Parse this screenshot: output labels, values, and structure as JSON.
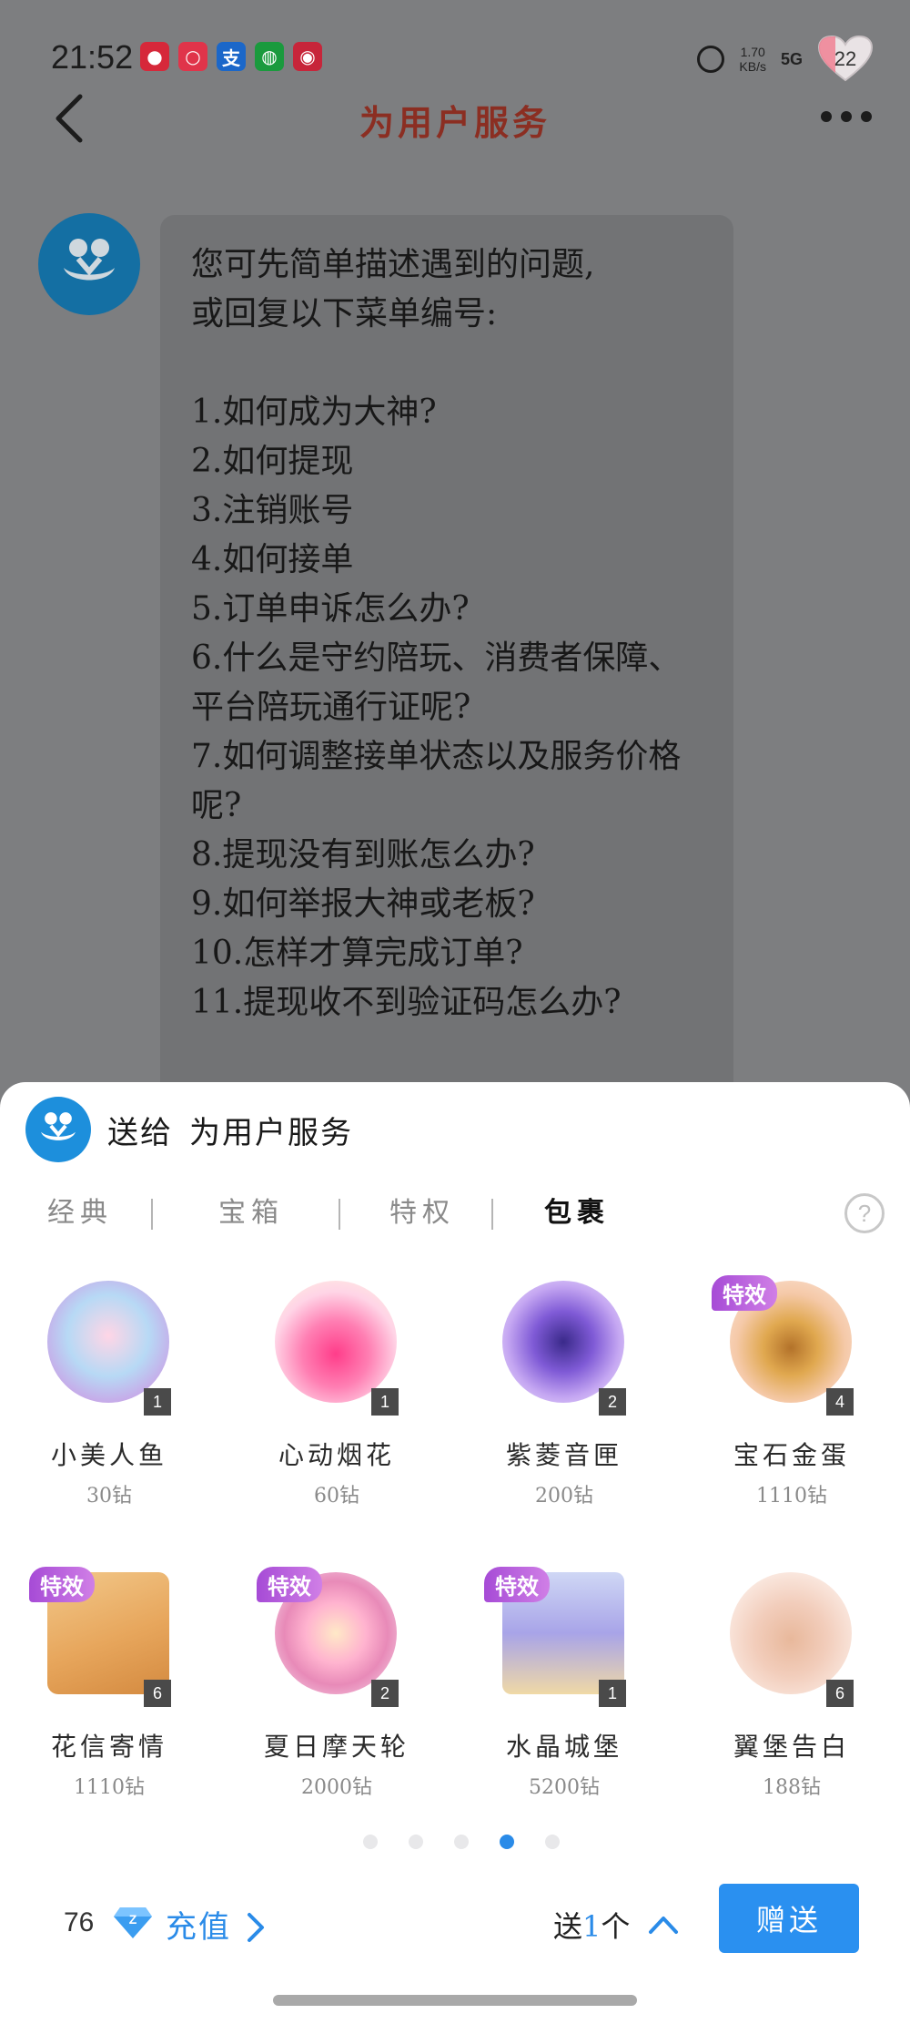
{
  "status_bar": {
    "time": "21:52",
    "net_speed_value": "1.70",
    "net_speed_unit": "KB/s",
    "signal": "5G",
    "battery": "22",
    "app_icons": [
      "weibo-icon",
      "chat-bubble-icon",
      "alipay-icon",
      "wechat-icon",
      "unionpay-icon"
    ]
  },
  "nav": {
    "title": "为用户服务"
  },
  "chat": {
    "message": "您可先简单描述遇到的问题,\n或回复以下菜单编号:\n\n1.如何成为大神?\n2.如何提现\n3.注销账号\n4.如何接单\n5.订单申诉怎么办?\n6.什么是守约陪玩、消费者保障、平台陪玩通行证呢?\n7.如何调整接单状态以及服务价格呢?\n8.提现没有到账怎么办?\n9.如何举报大神或老板?\n10.怎样才算完成订单?\n11.提现收不到验证码怎么办?"
  },
  "gift_sheet": {
    "send_to_prefix": "送给",
    "recipient": "为用户服务",
    "tabs": [
      {
        "label": "经典",
        "active": false
      },
      {
        "label": "宝箱",
        "active": false
      },
      {
        "label": "特权",
        "active": false
      },
      {
        "label": "包裹",
        "active": true
      }
    ],
    "help_label": "?",
    "gifts": [
      {
        "name": "小美人鱼",
        "price": "30钻",
        "count": "1",
        "badge": ""
      },
      {
        "name": "心动烟花",
        "price": "60钻",
        "count": "1",
        "badge": ""
      },
      {
        "name": "紫菱音匣",
        "price": "200钻",
        "count": "2",
        "badge": ""
      },
      {
        "name": "宝石金蛋",
        "price": "1110钻",
        "count": "4",
        "badge": "特效"
      },
      {
        "name": "花信寄情",
        "price": "1110钻",
        "count": "6",
        "badge": "特效"
      },
      {
        "name": "夏日摩天轮",
        "price": "2000钻",
        "count": "2",
        "badge": "特效"
      },
      {
        "name": "水晶城堡",
        "price": "5200钻",
        "count": "1",
        "badge": "特效"
      },
      {
        "name": "翼堡告白",
        "price": "188钻",
        "count": "6",
        "badge": ""
      }
    ],
    "pagination": {
      "pages": 5,
      "current": 4
    },
    "balance": "76",
    "recharge_label": "充值",
    "send_prefix": "送",
    "send_quantity": "1",
    "send_suffix": "个",
    "give_button": "赠送"
  },
  "colors": {
    "accent": "#2a8be8",
    "badge": "#b055d9",
    "title": "#8b2e22",
    "overlay": "#7d7e80"
  }
}
